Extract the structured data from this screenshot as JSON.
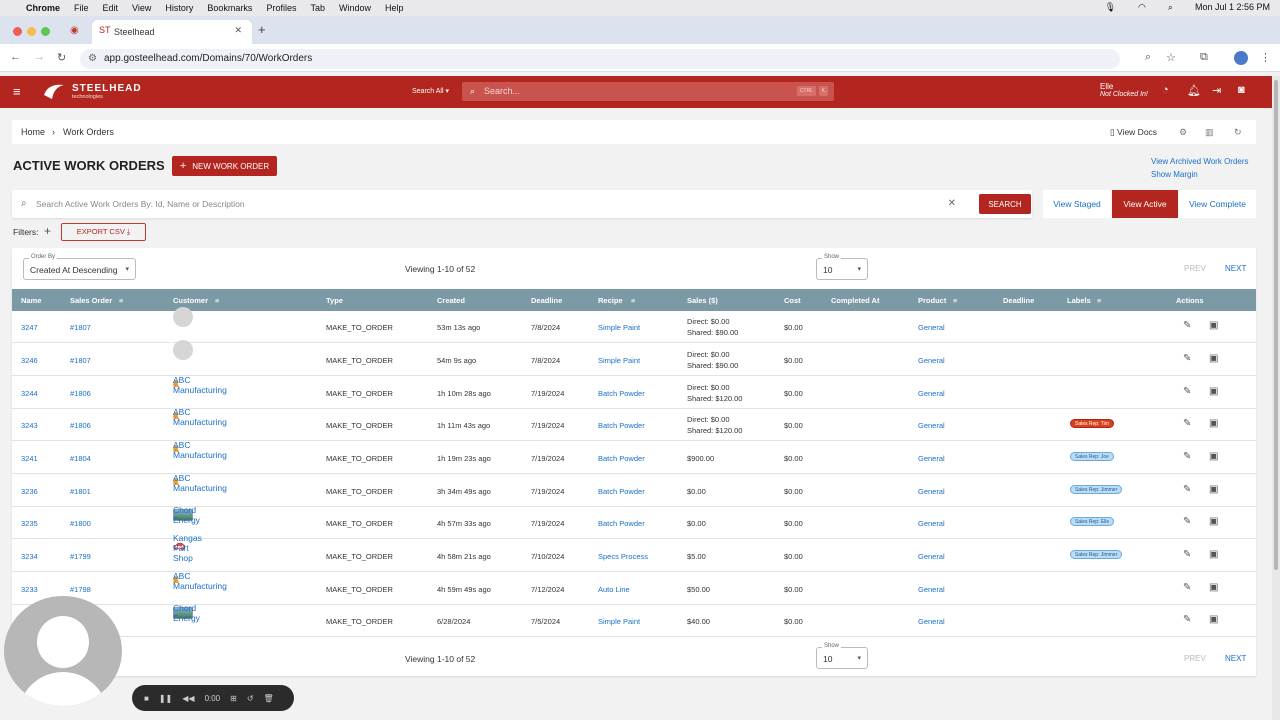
{
  "macos": {
    "app": "Chrome",
    "menu": [
      "File",
      "Edit",
      "View",
      "History",
      "Bookmarks",
      "Profiles",
      "Tab",
      "Window",
      "Help"
    ],
    "clock": "Mon Jul 1  2:56 PM"
  },
  "browser": {
    "tab_title": "Steelhead",
    "url": "app.gosteelhead.com/Domains/70/WorkOrders"
  },
  "header": {
    "brand": "STEELHEAD",
    "brand_sub": "technologies",
    "search_scope": "Search All",
    "search_placeholder": "Search...",
    "search_shortcut_1": "CTRL",
    "search_shortcut_2": "K",
    "user_name": "Elle",
    "user_status": "Not Clocked In!"
  },
  "breadcrumb": {
    "home": "Home",
    "current": "Work Orders",
    "view_docs": "View Docs"
  },
  "page": {
    "title": "ACTIVE WORK ORDERS",
    "new_button": "NEW WORK ORDER",
    "link_archived": "View Archived Work Orders",
    "link_margin": "Show Margin",
    "search_placeholder": "Search Active Work Orders By: Id, Name or Description",
    "search_button": "SEARCH",
    "view_staged": "View Staged",
    "view_active": "View Active",
    "view_complete": "View Complete",
    "filters_label": "Filters:",
    "export_csv": "EXPORT CSV"
  },
  "list": {
    "order_by_label": "Order By",
    "order_by_value": "Created At Descending",
    "viewing": "Viewing 1-10 of 52",
    "show_label": "Show",
    "show_value": "10",
    "prev": "PREV",
    "next": "NEXT"
  },
  "columns": {
    "name": "Name",
    "sales_order": "Sales Order",
    "customer": "Customer",
    "type": "Type",
    "created": "Created",
    "deadline": "Deadline",
    "recipe": "Recipe",
    "sales": "Sales ($)",
    "cost": "Cost",
    "completed_at": "Completed At",
    "product": "Product",
    "deadline2": "Deadline",
    "labels": "Labels",
    "actions": "Actions"
  },
  "rows": [
    {
      "name": "3247",
      "so": "#1807",
      "customer": "",
      "logo": "avatar",
      "type": "MAKE_TO_ORDER",
      "created": "53m 13s ago",
      "deadline": "7/8/2024",
      "recipe": "Simple Paint",
      "sales1": "Direct: $0.00",
      "sales2": "Shared: $90.00",
      "cost": "$0.00",
      "product": "General",
      "label": "",
      "label_color": ""
    },
    {
      "name": "3246",
      "so": "#1807",
      "customer": "",
      "logo": "avatar",
      "type": "MAKE_TO_ORDER",
      "created": "54m 9s ago",
      "deadline": "7/8/2024",
      "recipe": "Simple Paint",
      "sales1": "Direct: $0.00",
      "sales2": "Shared: $90.00",
      "cost": "$0.00",
      "product": "General",
      "label": "",
      "label_color": ""
    },
    {
      "name": "3244",
      "so": "#1806",
      "customer": "ABC Manufacturing",
      "logo": "abc",
      "type": "MAKE_TO_ORDER",
      "created": "1h 10m 28s ago",
      "deadline": "7/19/2024",
      "recipe": "Batch Powder",
      "sales1": "Direct: $0.00",
      "sales2": "Shared: $120.00",
      "cost": "$0.00",
      "product": "General",
      "label": "",
      "label_color": ""
    },
    {
      "name": "3243",
      "so": "#1806",
      "customer": "ABC Manufacturing",
      "logo": "abc",
      "type": "MAKE_TO_ORDER",
      "created": "1h 11m 43s ago",
      "deadline": "7/19/2024",
      "recipe": "Batch Powder",
      "sales1": "Direct: $0.00",
      "sales2": "Shared: $120.00",
      "cost": "$0.00",
      "product": "General",
      "label": "Sales Rep: Tim",
      "label_color": "#d9411e"
    },
    {
      "name": "3241",
      "so": "#1804",
      "customer": "ABC Manufacturing",
      "logo": "abc",
      "type": "MAKE_TO_ORDER",
      "created": "1h 19m 23s ago",
      "deadline": "7/19/2024",
      "recipe": "Batch Powder",
      "sales1": "$900.00",
      "sales2": "",
      "cost": "$0.00",
      "product": "General",
      "label": "Sales Rep: Joe",
      "label_color": "#b9dcf7"
    },
    {
      "name": "3236",
      "so": "#1801",
      "customer": "ABC Manufacturing",
      "logo": "abc",
      "type": "MAKE_TO_ORDER",
      "created": "3h 34m 49s ago",
      "deadline": "7/19/2024",
      "recipe": "Batch Powder",
      "sales1": "$0.00",
      "sales2": "",
      "cost": "$0.00",
      "product": "General",
      "label": "Sales Rep: Jimmer",
      "label_color": "#b9dcf7"
    },
    {
      "name": "3235",
      "so": "#1800",
      "customer": "Chord Energy",
      "logo": "chord",
      "type": "MAKE_TO_ORDER",
      "created": "4h 57m 33s ago",
      "deadline": "7/19/2024",
      "recipe": "Batch Powder",
      "sales1": "$0.00",
      "sales2": "",
      "cost": "$0.00",
      "product": "General",
      "label": "Sales Rep: Elle",
      "label_color": "#b9dcf7"
    },
    {
      "name": "3234",
      "so": "#1799",
      "customer": "Kangas Part Shop",
      "logo": "kangas",
      "type": "MAKE_TO_ORDER",
      "created": "4h 58m 21s ago",
      "deadline": "7/10/2024",
      "recipe": "Specs Process",
      "sales1": "$5.00",
      "sales2": "",
      "cost": "$0.00",
      "product": "General",
      "label": "Sales Rep: Jimmer",
      "label_color": "#b9dcf7"
    },
    {
      "name": "3233",
      "so": "#1798",
      "customer": "ABC Manufacturing",
      "logo": "abc",
      "type": "MAKE_TO_ORDER",
      "created": "4h 59m 49s ago",
      "deadline": "7/12/2024",
      "recipe": "Auto Line",
      "sales1": "$50.00",
      "sales2": "",
      "cost": "$0.00",
      "product": "General",
      "label": "",
      "label_color": ""
    },
    {
      "name": "",
      "so": "",
      "customer": "Chord Energy",
      "logo": "chord",
      "type": "MAKE_TO_ORDER",
      "created": "6/28/2024",
      "deadline": "7/5/2024",
      "recipe": "Simple Paint",
      "sales1": "$40.00",
      "sales2": "",
      "cost": "$0.00",
      "product": "General",
      "label": "",
      "label_color": ""
    }
  ],
  "recorder": {
    "time": "0:00"
  },
  "colors": {
    "brand_red": "#b2261f",
    "table_header": "#7c9aa6",
    "link_blue": "#1a6fc9"
  }
}
